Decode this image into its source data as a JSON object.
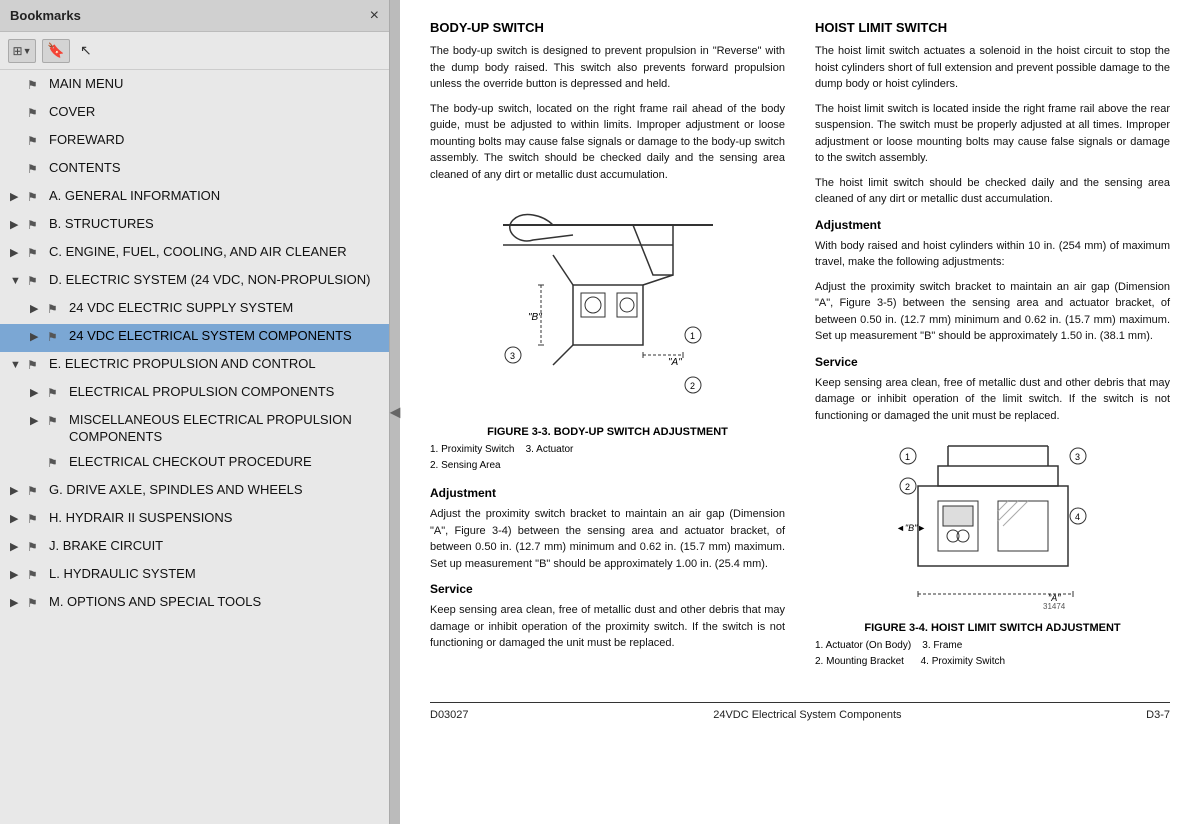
{
  "header": {
    "title": "Bookmarks",
    "close_label": "×"
  },
  "toolbar": {
    "list_icon": "≡",
    "bookmark_icon": "🔖",
    "cursor_icon": "↖"
  },
  "bookmarks": [
    {
      "id": "main-menu",
      "label": "MAIN MENU",
      "level": 0,
      "expand": null,
      "active": false
    },
    {
      "id": "cover",
      "label": "COVER",
      "level": 0,
      "expand": null,
      "active": false
    },
    {
      "id": "forward",
      "label": "FOREWARD",
      "level": 0,
      "expand": null,
      "active": false
    },
    {
      "id": "contents",
      "label": "CONTENTS",
      "level": 0,
      "expand": null,
      "active": false
    },
    {
      "id": "general-info",
      "label": "A. GENERAL INFORMATION",
      "level": 0,
      "expand": "collapsed",
      "active": false
    },
    {
      "id": "structures",
      "label": "B. STRUCTURES",
      "level": 0,
      "expand": "collapsed",
      "active": false
    },
    {
      "id": "engine",
      "label": "C. ENGINE, FUEL, COOLING, AND AIR CLEANER",
      "level": 0,
      "expand": "collapsed",
      "active": false
    },
    {
      "id": "electric-sys",
      "label": "D. ELECTRIC SYSTEM (24 VDC, NON-PROPULSION)",
      "level": 0,
      "expand": "expanded",
      "active": false
    },
    {
      "id": "24vdc-supply",
      "label": "24 VDC ELECTRIC SUPPLY SYSTEM",
      "level": 1,
      "expand": "collapsed",
      "active": false
    },
    {
      "id": "24vdc-components",
      "label": "24 VDC ELECTRICAL SYSTEM COMPONENTS",
      "level": 1,
      "expand": "collapsed",
      "active": true
    },
    {
      "id": "electric-prop",
      "label": "E. ELECTRIC PROPULSION AND CONTROL",
      "level": 0,
      "expand": "expanded",
      "active": false
    },
    {
      "id": "elec-prop-components",
      "label": "ELECTRICAL PROPULSION COMPONENTS",
      "level": 1,
      "expand": "collapsed",
      "active": false
    },
    {
      "id": "misc-elec",
      "label": "MISCELLANEOUS ELECTRICAL PROPULSION COMPONENTS",
      "level": 1,
      "expand": "collapsed",
      "active": false
    },
    {
      "id": "elec-checkout",
      "label": "ELECTRICAL CHECKOUT PROCEDURE",
      "level": 1,
      "expand": null,
      "active": false
    },
    {
      "id": "drive-axle",
      "label": "G. DRIVE AXLE, SPINDLES AND WHEELS",
      "level": 0,
      "expand": "collapsed",
      "active": false
    },
    {
      "id": "hydrair",
      "label": "H. HYDRAIR II SUSPENSIONS",
      "level": 0,
      "expand": "collapsed",
      "active": false
    },
    {
      "id": "brake",
      "label": "J. BRAKE CIRCUIT",
      "level": 0,
      "expand": "collapsed",
      "active": false
    },
    {
      "id": "hydraulic",
      "label": "L. HYDRAULIC SYSTEM",
      "level": 0,
      "expand": "collapsed",
      "active": false
    },
    {
      "id": "options",
      "label": "M. OPTIONS AND SPECIAL TOOLS",
      "level": 0,
      "expand": "collapsed",
      "active": false
    }
  ],
  "document": {
    "left_column": {
      "title": "BODY-UP SWITCH",
      "para1": "The body-up switch is designed to prevent propulsion in \"Reverse\" with the dump body raised. This switch also prevents forward propulsion unless the override button is depressed and held.",
      "para2": "The body-up switch, located on the right frame rail ahead of the body guide, must be adjusted to within limits. Improper adjustment or loose mounting bolts may cause false signals or damage to the body-up switch assembly. The switch should be checked daily and the sensing area cleaned of any dirt or metallic dust accumulation.",
      "figure_caption": "FIGURE 3-3. BODY-UP SWITCH ADJUSTMENT",
      "figure_legend": [
        "1. Proximity Switch     3. Actuator",
        "2. Sensing Area"
      ],
      "adjustment_title": "Adjustment",
      "adjustment_text": "Adjust the proximity switch bracket to maintain an air gap (Dimension \"A\", Figure 3-4) between the sensing area and actuator bracket, of between 0.50 in. (12.7 mm) minimum and 0.62 in. (15.7 mm) maximum. Set up measurement \"B\" should be approximately 1.00 in. (25.4 mm).",
      "service_title": "Service",
      "service_text": "Keep sensing area clean, free of metallic dust and other debris that may damage or inhibit operation of the proximity switch. If the switch is not functioning or damaged the unit must be replaced."
    },
    "right_column": {
      "title": "HOIST LIMIT SWITCH",
      "para1": "The hoist limit switch actuates a solenoid in the hoist circuit to stop the hoist cylinders short of full extension and prevent possible damage to the dump body or hoist cylinders.",
      "para2": "The hoist limit switch is located inside the right frame rail above the rear suspension. The switch must be properly adjusted at all times. Improper adjustment or loose mounting bolts may cause false signals or damage to the switch assembly.",
      "para3": "The hoist limit switch should be checked daily and the sensing area cleaned of any dirt or metallic dust accumulation.",
      "adjustment_title": "Adjustment",
      "adjustment_text": "With body raised and hoist cylinders within 10 in. (254 mm) of maximum travel, make the following adjustments:",
      "adjustment_text2": "Adjust the proximity switch bracket to maintain an air gap (Dimension \"A\", Figure 3-5) between the sensing area and actuator bracket, of between 0.50 in. (12.7 mm) minimum and 0.62 in. (15.7 mm) maximum. Set up measurement \"B\" should be approximately 1.50 in. (38.1 mm).",
      "service_title": "Service",
      "service_text": "Keep sensing area clean, free of metallic dust and other debris that may damage or inhibit operation of the limit switch. If the switch is not functioning or damaged the unit must be replaced.",
      "figure_caption": "FIGURE 3-4. HOIST LIMIT SWITCH ADJUSTMENT",
      "figure_legend": [
        "1. Actuator (On Body)     3. Frame",
        "2. Mounting Bracket       4. Proximity Switch"
      ],
      "figure_number": "31474"
    },
    "footer": {
      "left": "D03027",
      "center": "24VDC Electrical System Components",
      "right": "D3-7"
    }
  }
}
